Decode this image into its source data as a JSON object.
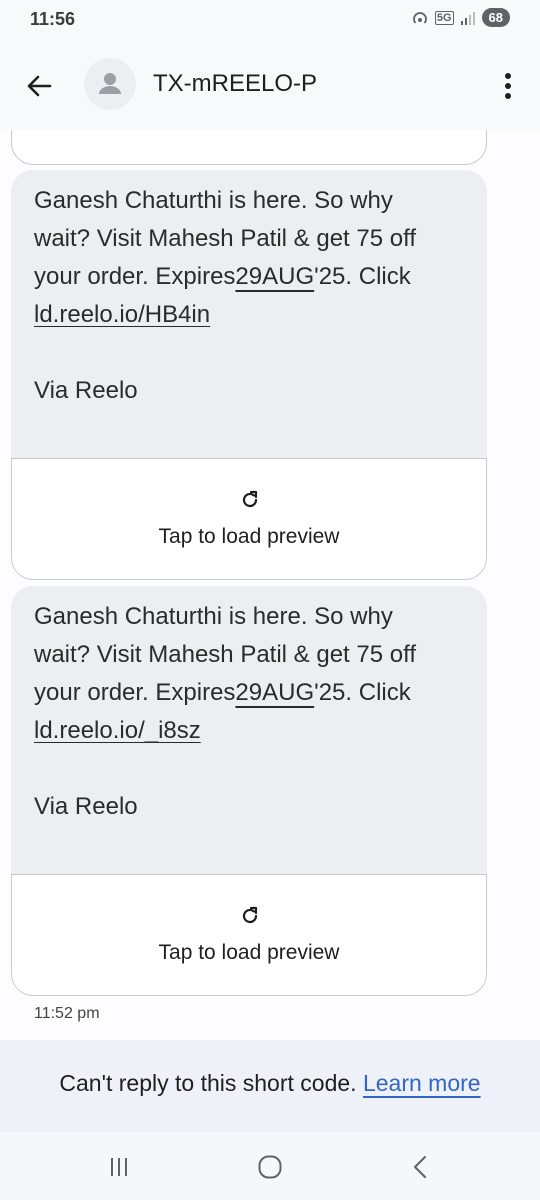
{
  "status_bar": {
    "time": "11:56",
    "network": "5G",
    "battery": "68",
    "icons": [
      "hotspot-icon",
      "network-5g-icon",
      "signal-icon",
      "battery-icon"
    ]
  },
  "app_bar": {
    "title": "TX-mREELO-P",
    "icons": [
      "back-arrow-icon",
      "contact-avatar-icon",
      "more-vert-icon"
    ]
  },
  "messages": [
    {
      "line1": "Ganesh Chaturthi is here. So why",
      "line2": "wait? Visit Mahesh Patil & get 75 off",
      "line3_pre": "your order. Expires",
      "line3_date": "29AUG",
      "line3_post": "'25. Click",
      "link": "ld.reelo.io/HB4in",
      "signature": "Via Reelo",
      "preview_label": "Tap to load preview"
    },
    {
      "line1": "Ganesh Chaturthi is here. So why",
      "line2": "wait? Visit Mahesh Patil & get 75 off",
      "line3_pre": "your order. Expires",
      "line3_date": "29AUG",
      "line3_post": "'25. Click",
      "link": "ld.reelo.io/_i8sz",
      "signature": "Via Reelo",
      "preview_label": "Tap to load preview"
    }
  ],
  "timestamp": "11:52 pm",
  "footer": {
    "text": "Can't reply to this short code.",
    "link": "Learn more"
  },
  "nav_bar": {
    "icons": [
      "recent-apps-icon",
      "home-icon",
      "back-nav-icon"
    ]
  },
  "colors": {
    "bubble": "#eceef2",
    "link": "#3367c6",
    "footer_bg": "#eef1f7"
  }
}
